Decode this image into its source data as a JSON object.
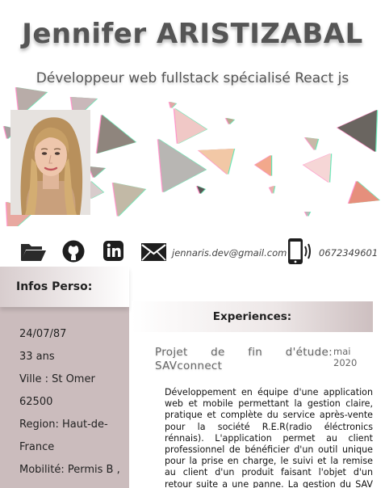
{
  "header": {
    "name": "Jennifer ARISTIZABAL",
    "subtitle": "Développeur web fullstack spécialisé React js"
  },
  "photo": {
    "alt": "profile photo"
  },
  "contacts": {
    "icons": [
      "folder-icon",
      "github-icon",
      "linkedin-icon",
      "mail-icon",
      "phone-icon"
    ],
    "email": "jennaris.dev@gmail.com",
    "phone": "0672349601"
  },
  "perso": {
    "title": "Infos Perso:",
    "items": [
      "24/07/87",
      "33 ans",
      "Ville : St Omer",
      "62500",
      "Region: Haut-de-",
      "France",
      "Mobilité: Permis B ,"
    ]
  },
  "experiences": {
    "title": "Experiences:",
    "project_title_line1": "Projet de fin d'étude:",
    "project_title_line2": "SAVconnect",
    "project_date_month": "mai",
    "project_date_year": "2020",
    "project_description": "Développement en équipe d'une application web et mobile permettant la gestion claire, pratique et complète du service après-vente pour la société R.E.R(radio éléctronics rénnais). L'application permet au client professionnel de bénéficier d'un outil unique pour la prise en charge, le suivi et la remise au client d'un produit faisant l'objet d'un retour suite a une panne. La gestion du SAV est, de"
  },
  "colors": {
    "panel": "#cbbcbd",
    "name_text": "#555555"
  }
}
